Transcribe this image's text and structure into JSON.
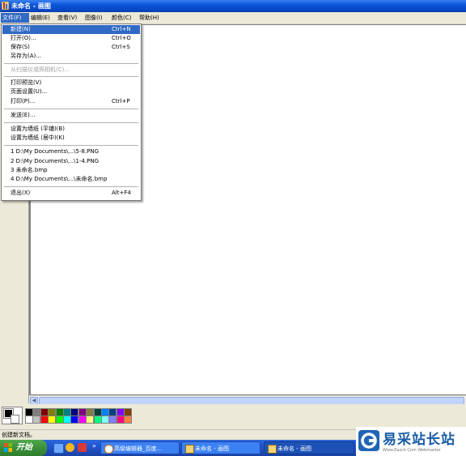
{
  "window": {
    "title": "未命名 - 画图"
  },
  "menubar": {
    "items": [
      {
        "label": "文件(F)"
      },
      {
        "label": "编辑(E)"
      },
      {
        "label": "查看(V)"
      },
      {
        "label": "图像(I)"
      },
      {
        "label": "颜色(C)"
      },
      {
        "label": "帮助(H)"
      }
    ]
  },
  "file_menu": {
    "items": [
      {
        "label": "新建(N)",
        "shortcut": "Ctrl+N"
      },
      {
        "label": "打开(O)...",
        "shortcut": "Ctrl+O"
      },
      {
        "label": "保存(S)",
        "shortcut": "Ctrl+S"
      },
      {
        "label": "另存为(A)...",
        "shortcut": ""
      },
      {
        "label": "从扫描仪或照相机(C)...",
        "shortcut": ""
      },
      {
        "label": "打印预览(V)",
        "shortcut": ""
      },
      {
        "label": "页面设置(U)...",
        "shortcut": ""
      },
      {
        "label": "打印(P)...",
        "shortcut": "Ctrl+P"
      },
      {
        "label": "发送(E)...",
        "shortcut": ""
      },
      {
        "label": "设置为墙纸 (平铺)(B)",
        "shortcut": ""
      },
      {
        "label": "设置为墙纸 (居中)(K)",
        "shortcut": ""
      },
      {
        "label": "1 D:\\My Documents\\...\\5-8.PNG",
        "shortcut": ""
      },
      {
        "label": "2 D:\\My Documents\\...\\1-4.PNG",
        "shortcut": ""
      },
      {
        "label": "3 未命名.bmp",
        "shortcut": ""
      },
      {
        "label": "4 D:\\My Documents\\...\\未命名.bmp",
        "shortcut": ""
      },
      {
        "label": "退出(X)",
        "shortcut": "Alt+F4"
      }
    ]
  },
  "palette": {
    "colors": [
      "#000000",
      "#808080",
      "#800000",
      "#808000",
      "#008000",
      "#008080",
      "#000080",
      "#800080",
      "#808040",
      "#004040",
      "#0080ff",
      "#004080",
      "#8000ff",
      "#804000",
      "#ffffff",
      "#c0c0c0",
      "#ff0000",
      "#ffff00",
      "#00ff00",
      "#00ffff",
      "#0000ff",
      "#ff00ff",
      "#ffff80",
      "#00ff80",
      "#80ffff",
      "#8080ff",
      "#ff0080",
      "#ff8040"
    ]
  },
  "statusbar": {
    "text": "创建新文档。"
  },
  "taskbar": {
    "start_label": "开始",
    "buttons": [
      {
        "label": "高级编辑器_百度..."
      },
      {
        "label": "未命名 - 画图"
      },
      {
        "label": "未命名 - 画图"
      }
    ]
  },
  "watermark": {
    "title": "易采站长站",
    "subtitle": "Www.Easck.Com  Webmaster"
  },
  "colors": {
    "menu_highlight": "#316ac5",
    "titlebar": "#0a55d8",
    "taskbar": "#245edb",
    "start": "#3c8f3a"
  }
}
